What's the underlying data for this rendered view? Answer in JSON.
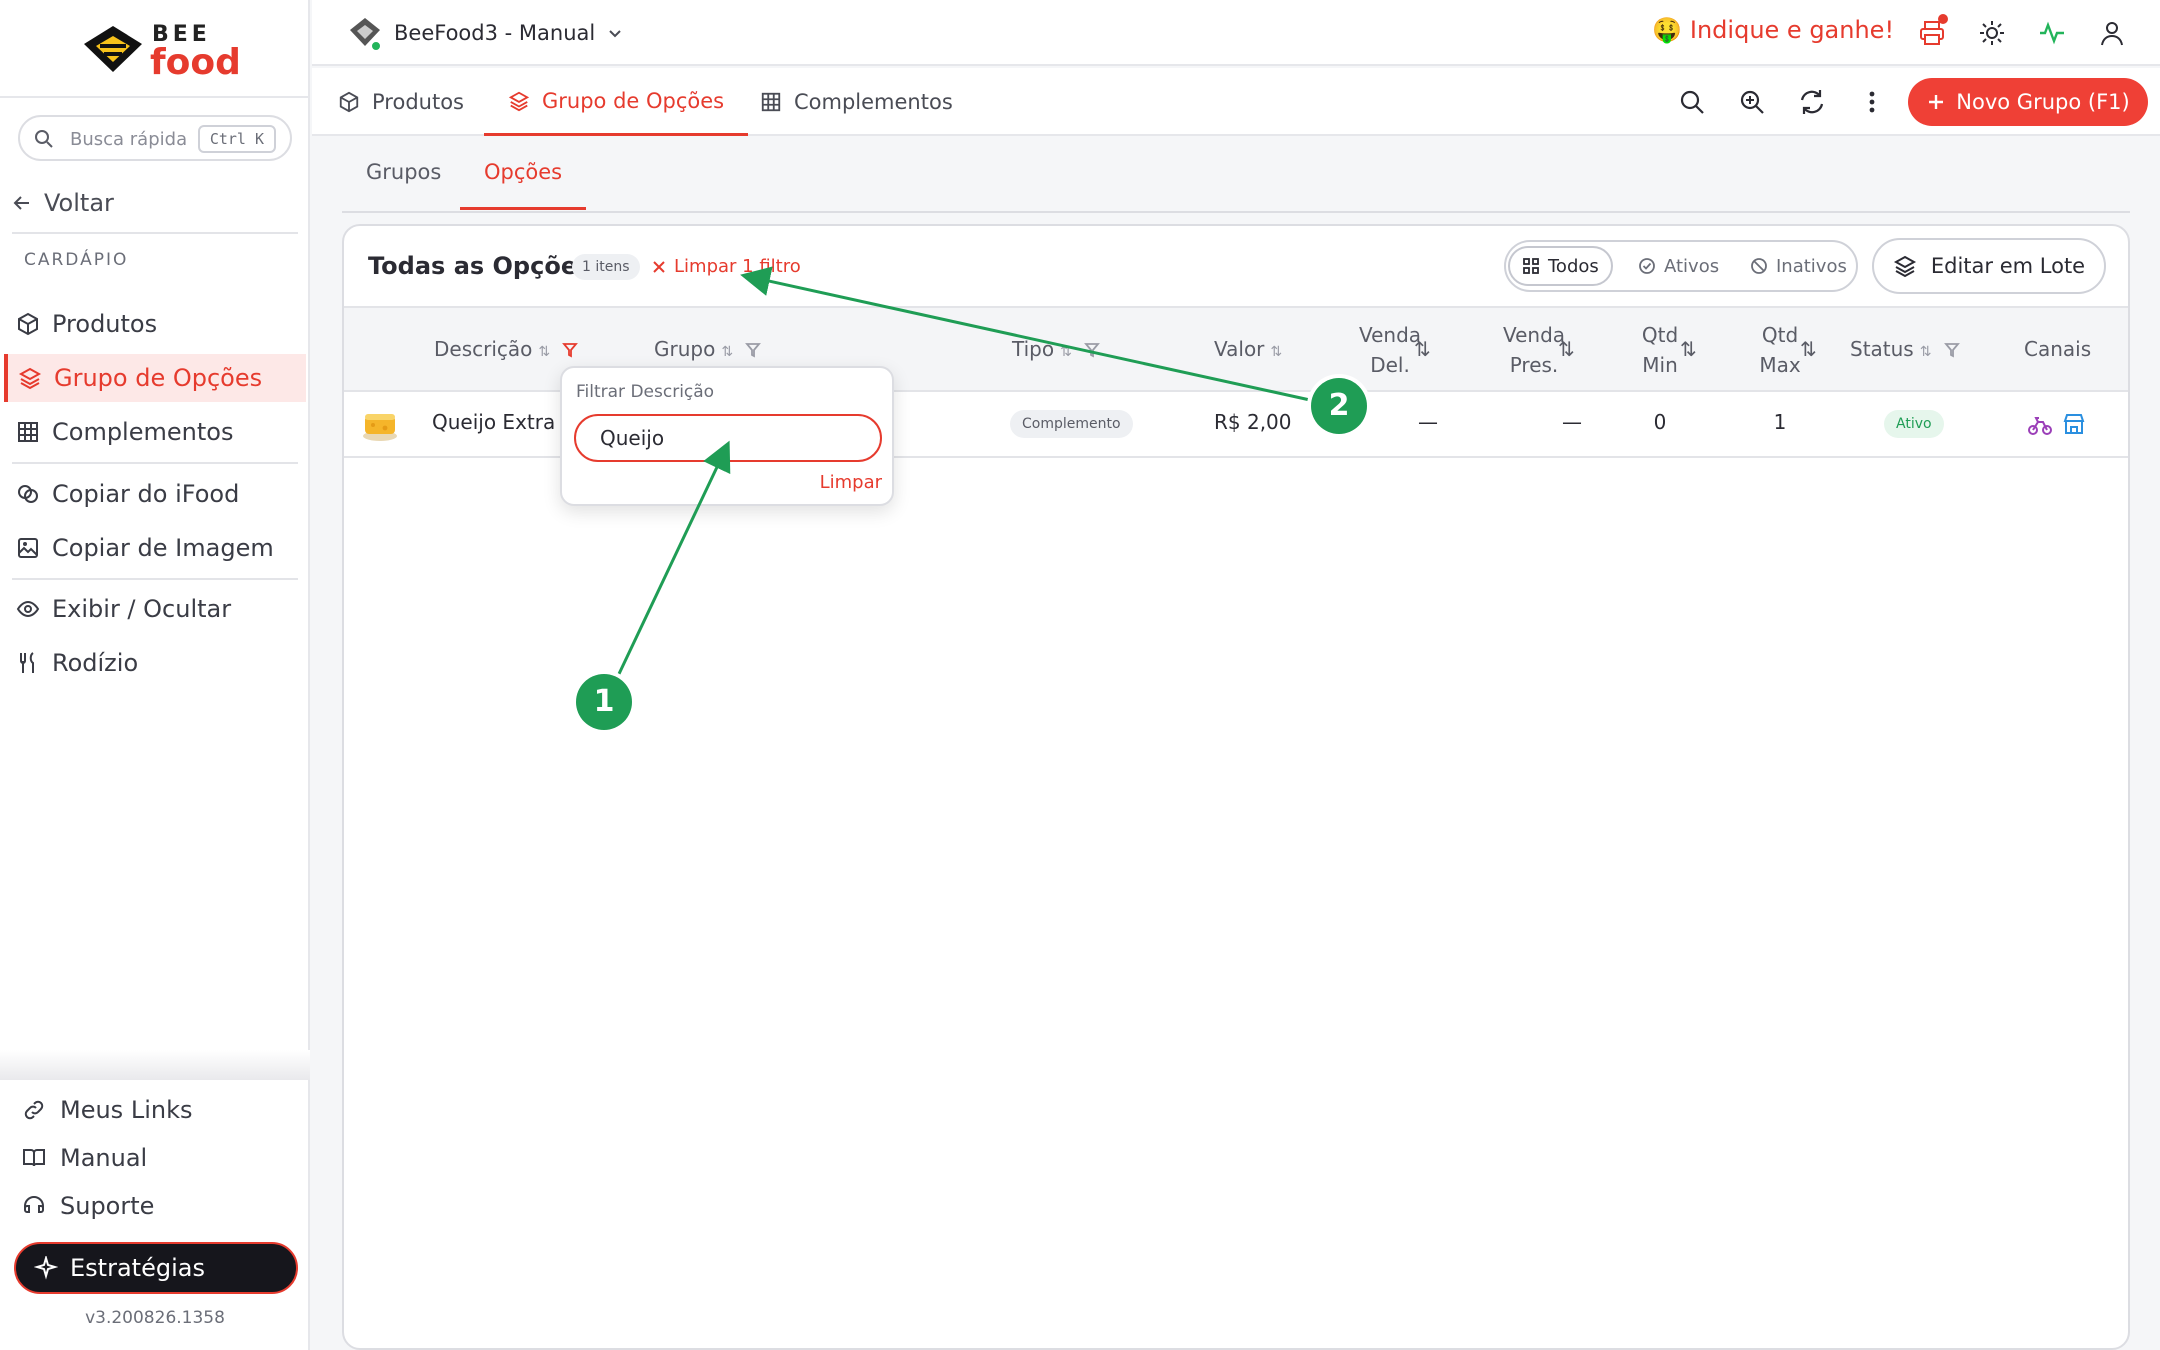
{
  "brand": {
    "logo_top": "BEE",
    "logo_bottom": "food"
  },
  "sidebar": {
    "search_placeholder": "Busca rápida",
    "search_shortcut": "Ctrl K",
    "back_label": "Voltar",
    "section_label": "CARDÁPIO",
    "items": [
      {
        "label": "Produtos",
        "icon": "box-icon"
      },
      {
        "label": "Grupo de Opções",
        "icon": "layers-icon",
        "active": true
      },
      {
        "label": "Complementos",
        "icon": "grid-icon"
      },
      {
        "label": "Copiar do iFood",
        "icon": "copy-icon"
      },
      {
        "label": "Copiar de Imagem",
        "icon": "image-edit-icon"
      },
      {
        "label": "Exibir / Ocultar",
        "icon": "eye-icon"
      },
      {
        "label": "Rodízio",
        "icon": "utensils-icon"
      }
    ],
    "bottom": [
      {
        "label": "Meus Links",
        "icon": "link-icon"
      },
      {
        "label": "Manual",
        "icon": "book-icon"
      },
      {
        "label": "Suporte",
        "icon": "headset-icon"
      }
    ],
    "strategies_label": "Estratégias",
    "version": "v3.200826.1358"
  },
  "topbar": {
    "store_name": "BeeFood3 - Manual",
    "refer_emoji": "🤑",
    "refer_label": "Indique e ganhe!"
  },
  "tabs": [
    {
      "label": "Produtos"
    },
    {
      "label": "Grupo de Opções",
      "active": true
    },
    {
      "label": "Complementos"
    }
  ],
  "toolbar": {
    "new_button": "Novo Grupo (F1)"
  },
  "subtabs": [
    {
      "label": "Grupos"
    },
    {
      "label": "Opções",
      "active": true
    }
  ],
  "card": {
    "title": "Todas as Opções",
    "count": "1 itens",
    "clear_filter": "Limpar 1 filtro",
    "segments": [
      {
        "label": "Todos",
        "active": true
      },
      {
        "label": "Ativos"
      },
      {
        "label": "Inativos"
      }
    ],
    "batch_edit": "Editar em Lote"
  },
  "table": {
    "headers": {
      "descricao": "Descrição",
      "grupo": "Grupo",
      "tipo": "Tipo",
      "valor": "Valor",
      "venda_del_1": "Venda",
      "venda_del_2": "Del.",
      "venda_pres_1": "Venda",
      "venda_pres_2": "Pres.",
      "qtd_min_1": "Qtd",
      "qtd_min_2": "Min",
      "qtd_max_1": "Qtd",
      "qtd_max_2": "Max",
      "status": "Status",
      "canais": "Canais"
    },
    "rows": [
      {
        "descricao": "Queijo Extra",
        "tipo": "Complemento",
        "valor": "R$ 2,00",
        "venda_del": "—",
        "venda_pres": "—",
        "qtd_min": "0",
        "qtd_max": "1",
        "status": "Ativo"
      }
    ]
  },
  "filter_popover": {
    "label": "Filtrar Descrição",
    "value": "Queijo",
    "clear": "Limpar"
  },
  "annotations": {
    "step1": "1",
    "step2": "2"
  },
  "colors": {
    "accent": "#e63b2e",
    "step": "#1f9d55",
    "status_active": "#1f9d55"
  }
}
